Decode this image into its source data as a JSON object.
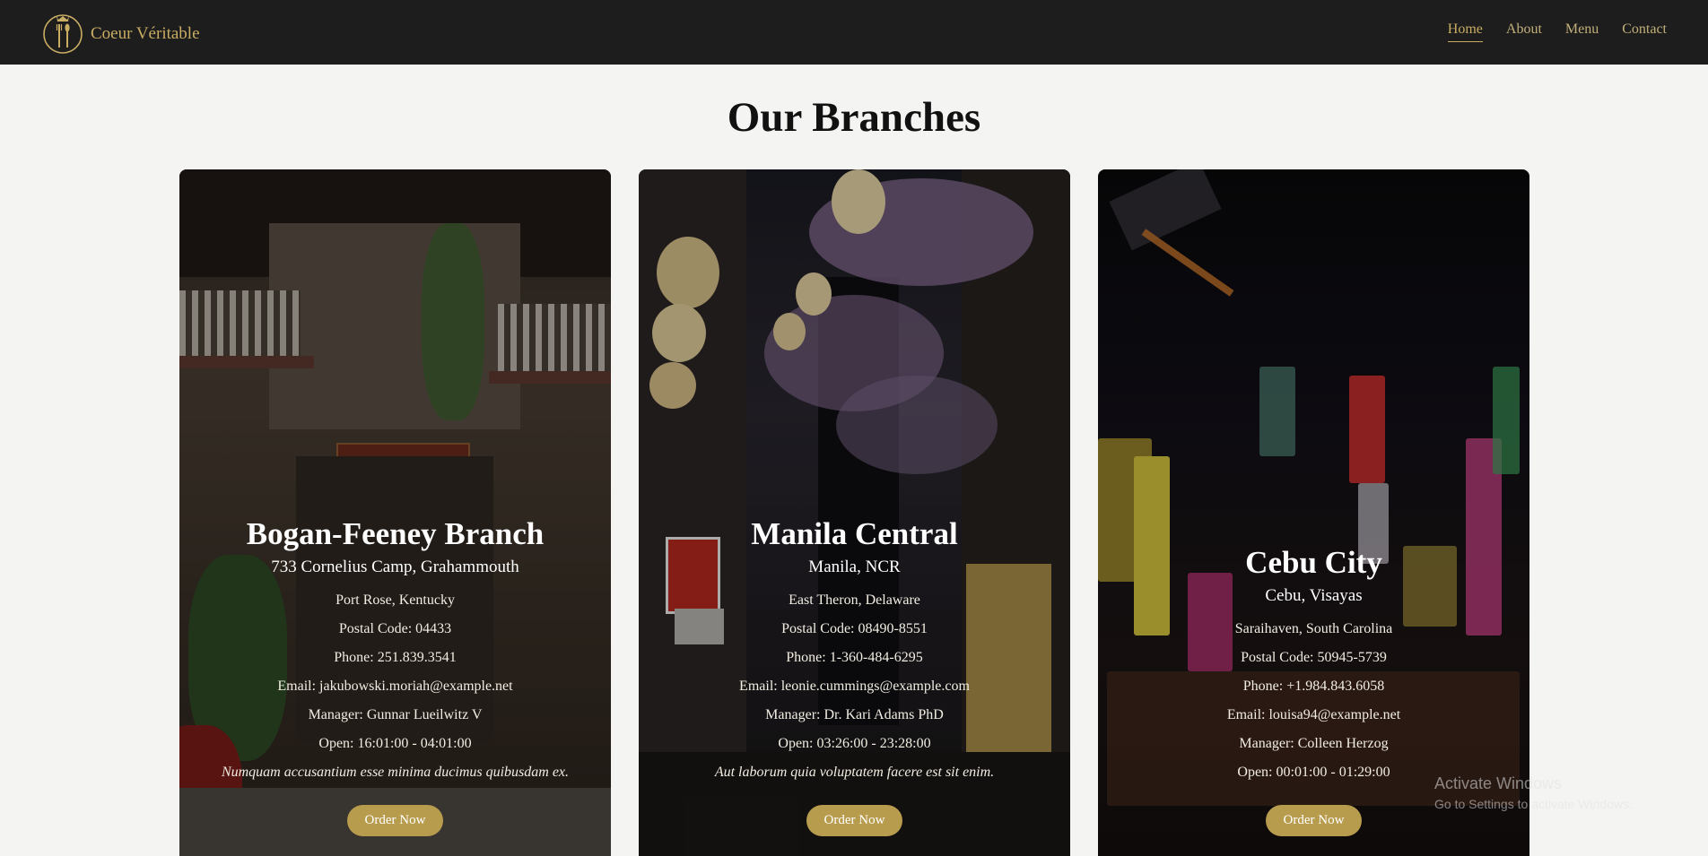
{
  "nav": {
    "brand": "Coeur Véritable",
    "links": [
      "Home",
      "About",
      "Menu",
      "Contact"
    ],
    "active": "Home"
  },
  "page": {
    "title": "Our Branches"
  },
  "branches": [
    {
      "name": "Bogan-Feeney Branch",
      "area": "733 Cornelius Camp, Grahammouth",
      "city": "Port Rose, Kentucky",
      "postal": "Postal Code: 04433",
      "phone": "Phone: 251.839.3541",
      "email": "Email: jakubowski.moriah@example.net",
      "manager": "Manager: Gunnar Lueilwitz V",
      "hours": "Open: 16:01:00 - 04:01:00",
      "tagline": "Numquam accusantium esse minima ducimus quibusdam ex.",
      "button": "Order Now"
    },
    {
      "name": "Manila Central",
      "area": "Manila, NCR",
      "city": "East Theron, Delaware",
      "postal": "Postal Code: 08490-8551",
      "phone": "Phone: 1-360-484-6295",
      "email": "Email: leonie.cummings@example.com",
      "manager": "Manager: Dr. Kari Adams PhD",
      "hours": "Open: 03:26:00 - 23:28:00",
      "tagline": "Aut laborum quia voluptatem facere est sit enim.",
      "button": "Order Now"
    },
    {
      "name": "Cebu City",
      "area": "Cebu, Visayas",
      "city": "Saraihaven, South Carolina",
      "postal": "Postal Code: 50945-5739",
      "phone": "Phone: +1.984.843.6058",
      "email": "Email: louisa94@example.net",
      "manager": "Manager: Colleen Herzog",
      "hours": "Open: 00:01:00 - 01:29:00",
      "button": "Order Now"
    }
  ],
  "os": {
    "watermark_title": "Activate Windows",
    "watermark_sub": "Go to Settings to activate Windows."
  },
  "colors": {
    "navbar": "#1d1d1d",
    "gold": "#c9ad62",
    "button": "#b89c4e",
    "page_bg": "#f4f4f2"
  }
}
